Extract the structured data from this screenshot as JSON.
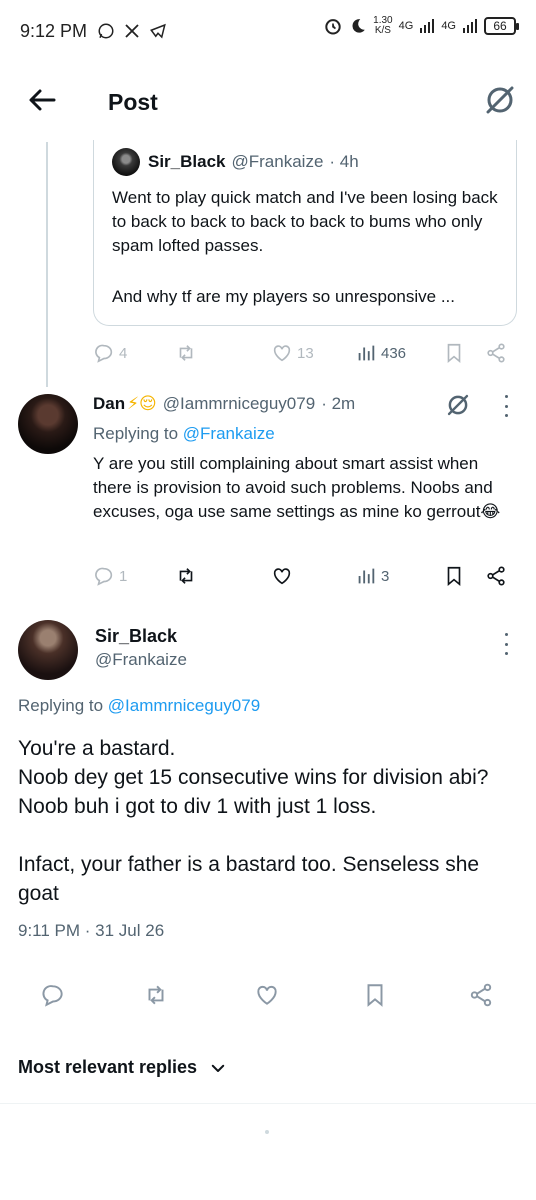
{
  "status_bar": {
    "time": "9:12 PM",
    "net_speed_value": "1.30",
    "net_speed_unit": "K/S",
    "signal1": "4G",
    "signal2": "4G",
    "battery": "66"
  },
  "header": {
    "title": "Post"
  },
  "quoted_tweet": {
    "name": "Sir_Black",
    "handle": "@Frankaize",
    "time": "· 4h",
    "text": "Went to play quick match and I've been losing back to back to back to back to back to bums who only spam lofted passes.",
    "text2": "And why tf are my players so unresponsive ..."
  },
  "parent_actions": {
    "replies": "4",
    "likes": "13",
    "views": "436"
  },
  "reply": {
    "name": "Dan",
    "emoji": "⚡😌",
    "handle": "@Iammrniceguy079",
    "time": "· 2m",
    "replying_prefix": "Replying to ",
    "replying_to": "@Frankaize",
    "text": "Y are you still complaining about smart assist when there is provision to avoid such problems. Noobs and excuses, oga use same settings as mine ko gerrout😂",
    "replies": "1",
    "views": "3"
  },
  "main_tweet": {
    "name": "Sir_Black",
    "handle": "@Frankaize",
    "replying_prefix": "Replying to ",
    "replying_to": "@Iammrniceguy079",
    "text": "You're a bastard.\nNoob dey get 15 consecutive wins for division abi? Noob buh i got to div 1 with just 1 loss.\n\nInfact, your father is a bastard too. Senseless she goat",
    "timestamp": "9:11 PM · 31 Jul 26"
  },
  "sort": {
    "label": "Most relevant replies"
  },
  "colors": {
    "accent": "#1d9bf0",
    "muted": "#536471",
    "text": "#0f1419",
    "border": "#cfd9de"
  }
}
